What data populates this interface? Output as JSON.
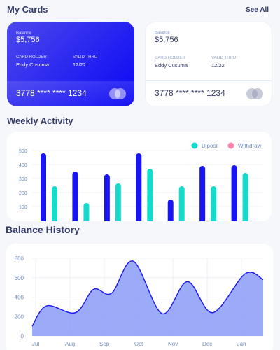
{
  "my_cards": {
    "title": "My Cards",
    "see_all": "See All",
    "cards": [
      {
        "balance_label": "Balance",
        "balance": "$5,756",
        "holder_label": "CARD HOLDER",
        "holder": "Eddy Cusuma",
        "valid_label": "VALID THRU",
        "valid": "12/22",
        "number": "3778 **** **** 1234"
      },
      {
        "balance_label": "Balance",
        "balance": "$5,756",
        "holder_label": "CARD HOLDER",
        "holder": "Eddy Cusuma",
        "valid_label": "VALID THRU",
        "valid": "12/22",
        "number": "3778 **** **** 1234"
      }
    ]
  },
  "weekly_activity": {
    "title": "Weekly Activity"
  },
  "balance_history": {
    "title": "Balance History"
  },
  "colors": {
    "primary": "#1814f3",
    "teal": "#16dbcc",
    "pink": "#ff82ac",
    "area_fill": "#8a9cf7",
    "area_line": "#1814f3",
    "text_dark": "#343c6a",
    "muted": "#718ebf"
  },
  "chart_data": [
    {
      "type": "bar",
      "title": "Weekly Activity",
      "legend": [
        "Diposit",
        "Withdraw"
      ],
      "legend_placement": "top-right",
      "y_ticks": [
        100,
        200,
        300,
        400,
        500
      ],
      "ylim": [
        0,
        520
      ],
      "grid": true,
      "series": [
        {
          "name": "Diposit",
          "color": "#1814f3",
          "values": [
            480,
            350,
            330,
            480,
            150,
            390,
            395
          ]
        },
        {
          "name": "Withdraw",
          "color": "#16dbcc",
          "values": [
            245,
            125,
            265,
            370,
            245,
            245,
            340
          ]
        }
      ]
    },
    {
      "type": "area",
      "title": "Balance History",
      "x": [
        "Jul",
        "Aug",
        "Sep",
        "Oct",
        "Nov",
        "Dec",
        "Jan"
      ],
      "y_ticks": [
        0,
        200,
        400,
        600,
        800
      ],
      "ylim": [
        0,
        800
      ],
      "grid": true,
      "points": [
        {
          "x": 6.0,
          "y": 100
        },
        {
          "x": 6.4,
          "y": 310
        },
        {
          "x": 7.2,
          "y": 240
        },
        {
          "x": 7.7,
          "y": 480
        },
        {
          "x": 8.2,
          "y": 440
        },
        {
          "x": 8.8,
          "y": 770
        },
        {
          "x": 9.6,
          "y": 230
        },
        {
          "x": 10.3,
          "y": 560
        },
        {
          "x": 11.0,
          "y": 240
        },
        {
          "x": 11.9,
          "y": 640
        },
        {
          "x": 12.4,
          "y": 580
        }
      ]
    }
  ]
}
